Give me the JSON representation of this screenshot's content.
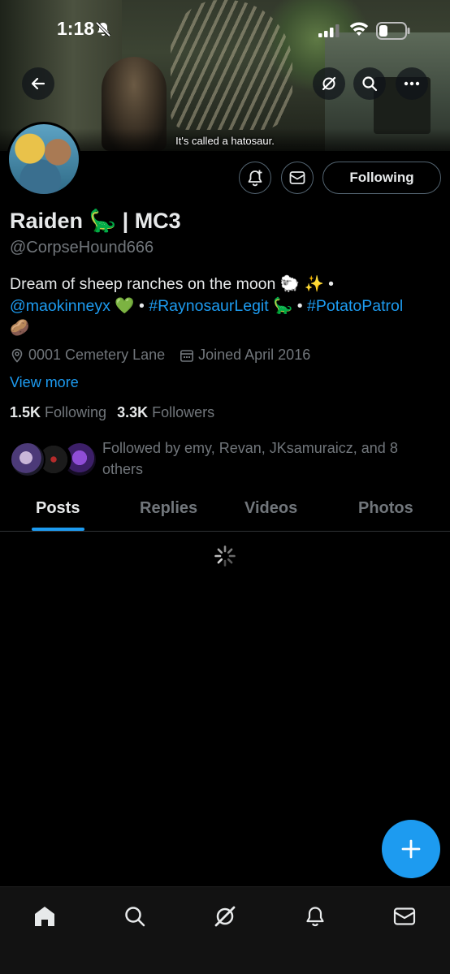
{
  "status_bar": {
    "time": "1:18"
  },
  "banner": {
    "caption": "It's called a hatosaur."
  },
  "header": {
    "back_icon": "back-arrow-icon",
    "grok_icon": "grok-icon",
    "search_icon": "search-icon",
    "more_icon": "more-icon"
  },
  "profile": {
    "display_name": "Raiden 🦕 | MC3",
    "handle": "@CorpseHound666",
    "bio": {
      "line1_text": "Dream of sheep ranches on the moon 🐑 ✨ •",
      "mention": "@maokinneyx",
      "heart": " 💚 • ",
      "hashtag1": "#RaynosaurLegit",
      "sep2": " 🦕 • ",
      "hashtag2": "#PotatoPatrol",
      "tail": "🥔"
    },
    "location": "0001 Cemetery Lane",
    "joined": "Joined April 2016",
    "view_more": "View more",
    "following_count": "1.5K",
    "following_label": "Following",
    "followers_count": "3.3K",
    "followers_label": "Followers",
    "followed_by": "Followed by emy, Revan, JKsamuraicz, and 8 others"
  },
  "actions": {
    "following_button": "Following"
  },
  "tabs": [
    {
      "label": "Posts",
      "active": true
    },
    {
      "label": "Replies",
      "active": false
    },
    {
      "label": "Videos",
      "active": false
    },
    {
      "label": "Photos",
      "active": false
    }
  ],
  "colors": {
    "accent": "#1d9bf0",
    "background": "#000000",
    "muted_text": "#71767b",
    "primary_text": "#e7e9ea"
  }
}
